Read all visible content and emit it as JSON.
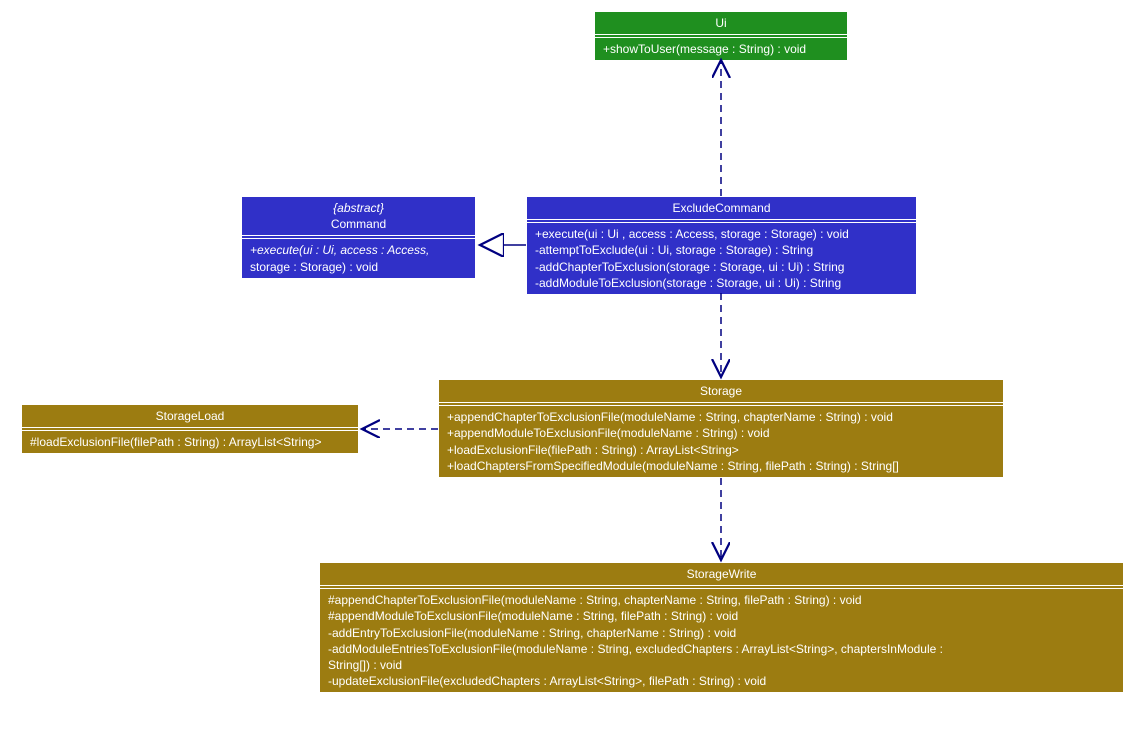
{
  "colors": {
    "green": "#1f8f1f",
    "blue": "#3030c8",
    "olive": "#9c7c11",
    "line": "#000080"
  },
  "classes": {
    "ui": {
      "title": "Ui",
      "methods": [
        "+showToUser(message : String) : void"
      ]
    },
    "command": {
      "stereotype": "{abstract}",
      "title": "Command",
      "methods": [
        "+execute(ui : Ui, access : Access,",
        "storage : Storage) : void"
      ]
    },
    "exclude": {
      "title": "ExcludeCommand",
      "methods": [
        "+execute(ui : Ui , access : Access, storage : Storage) : void",
        "-attemptToExclude(ui : Ui, storage : Storage) : String",
        "-addChapterToExclusion(storage : Storage, ui : Ui) : String",
        "-addModuleToExclusion(storage : Storage, ui : Ui) : String"
      ]
    },
    "storage": {
      "title": "Storage",
      "methods": [
        "+appendChapterToExclusionFile(moduleName : String, chapterName : String) : void",
        "+appendModuleToExclusionFile(moduleName : String) : void",
        "+loadExclusionFile(filePath : String) : ArrayList<String>",
        "+loadChaptersFromSpecifiedModule(moduleName : String, filePath : String) : String[]"
      ]
    },
    "storageLoad": {
      "title": "StorageLoad",
      "methods": [
        "#loadExclusionFile(filePath : String) : ArrayList<String>"
      ]
    },
    "storageWrite": {
      "title": "StorageWrite",
      "methods": [
        "#appendChapterToExclusionFile(moduleName : String, chapterName : String, filePath : String) : void",
        "#appendModuleToExclusionFile(moduleName : String, filePath : String) : void",
        "-addEntryToExclusionFile(moduleName : String, chapterName : String) : void",
        "-addModuleEntriesToExclusionFile(moduleName : String, excludedChapters : ArrayList<String>, chaptersInModule :",
        "String[]) : void",
        "-updateExclusionFile(excludedChapters : ArrayList<String>, filePath : String) : void"
      ]
    }
  }
}
